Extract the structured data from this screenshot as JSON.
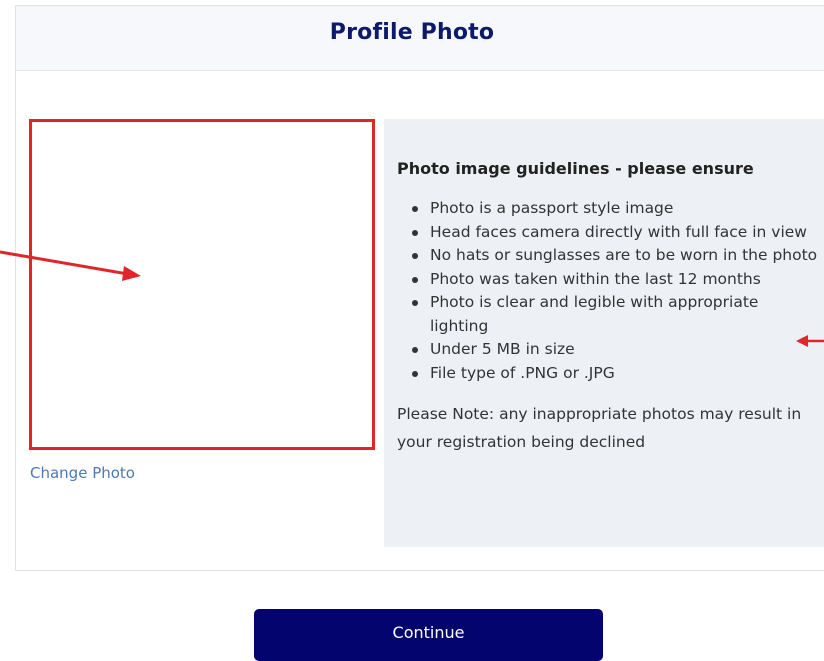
{
  "card": {
    "title": "Profile Photo"
  },
  "photo": {
    "change_label": "Change Photo"
  },
  "guidelines": {
    "title": "Photo image guidelines - please ensure",
    "items": [
      "Photo is a passport style image",
      "Head faces camera directly with full face in view",
      "No hats or sunglasses are to be worn in the photo",
      "Photo was taken within the last 12 months",
      "Photo is clear and legible with appropriate lighting",
      "Under 5 MB in size",
      "File type of .PNG or .JPG"
    ],
    "note": "Please Note: any inappropriate photos may result in your registration being declined"
  },
  "actions": {
    "continue_label": "Continue"
  },
  "colors": {
    "title": "#0b1a6b",
    "highlight": "#e0262b",
    "link": "#4a7ab8",
    "button": "#04046e",
    "panel": "#edf1f6"
  }
}
